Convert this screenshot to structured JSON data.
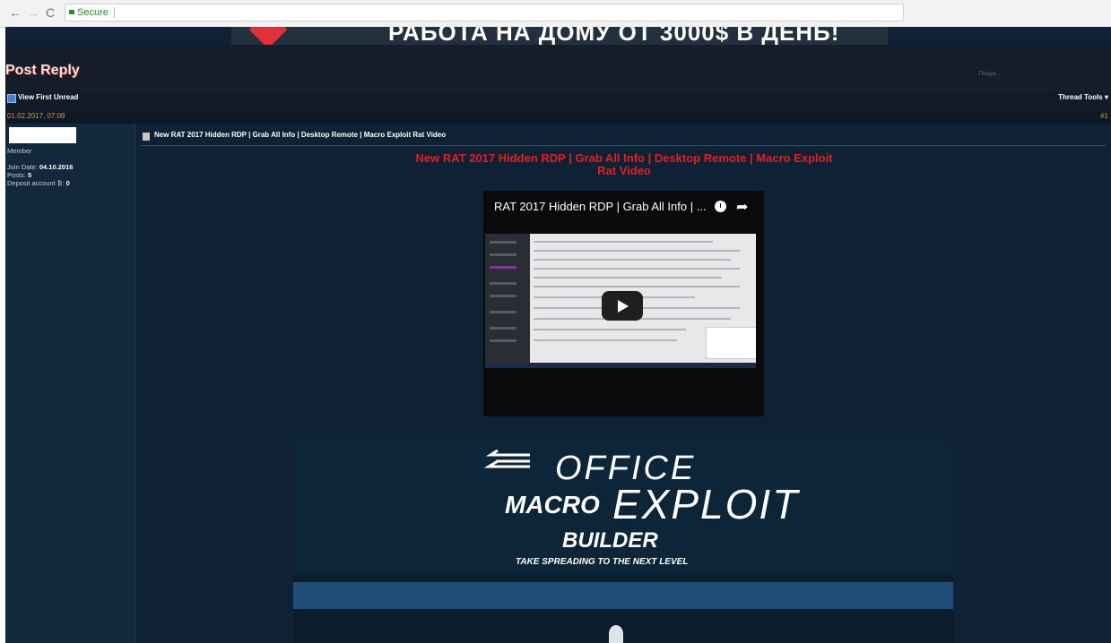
{
  "browser": {
    "back_icon": "←",
    "forward_icon": "→",
    "reload_icon": "C",
    "secure_label": "Secure"
  },
  "banner": {
    "text": "РАБОТА НА ДОМУ ОТ 3000$ В ДЕНЬ!"
  },
  "toolbar": {
    "post_reply": "Post Reply",
    "search_placeholder": "Пошук...",
    "view_first_unread": "View First Unread",
    "thread_tools": "Thread Tools ▾"
  },
  "post": {
    "date": "01.02.2017, 07:09",
    "number": "#1",
    "title": "New RAT 2017 Hidden RDP | Grab All Info | Desktop Remote | Macro Exploit Rat Video",
    "heading_line1": "New RAT 2017 Hidden RDP | Grab All Info | Desktop Remote | Macro Exploit",
    "heading_line2": "Rat Video"
  },
  "user": {
    "role": "Member",
    "join_label": "Join Date:",
    "join_date": "04.10.2016",
    "posts_label": "Posts:",
    "posts": "5",
    "deposit_label": "Deposit account ₿:",
    "deposit": "0"
  },
  "video": {
    "title": "RAT 2017 Hidden RDP | Grab All Info | ..."
  },
  "promo": {
    "office": "OFFICE",
    "macro": "MACRO",
    "exploit": "EXPLOIT",
    "builder": "BUILDER",
    "tagline": "TAKE SPREADING TO THE NEXT LEVEL"
  }
}
